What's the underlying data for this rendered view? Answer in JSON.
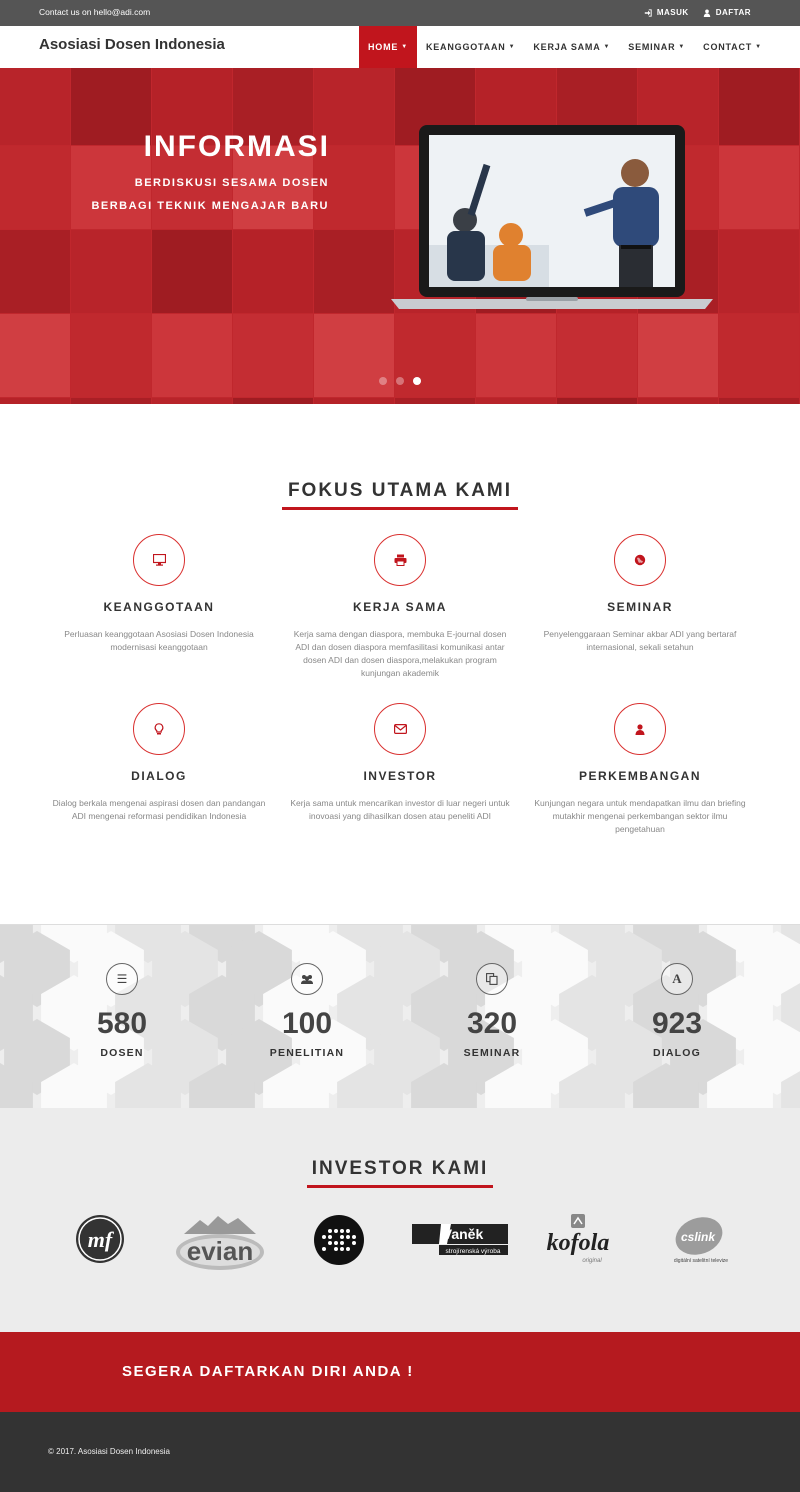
{
  "topbar": {
    "contact": "Contact us on hello@adi.com",
    "login": "MASUK",
    "register": "DAFTAR"
  },
  "navbar": {
    "brand": "Asosiasi Dosen Indonesia",
    "menu": [
      "HOME",
      "KEANGGOTAAN",
      "KERJA SAMA",
      "SEMINAR",
      "CONTACT"
    ],
    "active": "HOME"
  },
  "hero": {
    "title": "INFORMASI",
    "line1": "BERDISKUSI SESAMA DOSEN",
    "line2": "BERBAGI TEKNIK MENGAJAR BARU",
    "slides": 3,
    "active_slide": 3
  },
  "focus": {
    "title": "FOKUS UTAMA KAMI",
    "items": [
      {
        "icon": "monitor-icon",
        "title": "KEANGGOTAAN",
        "text": "Perluasan keanggotaan Asosiasi Dosen Indonesia modernisasi keanggotaan"
      },
      {
        "icon": "printer-icon",
        "title": "KERJA SAMA",
        "text": "Kerja sama dengan diaspora, membuka E-journal dosen ADI dan dosen diaspora memfasilitasi komunikasi antar dosen ADI dan dosen diaspora,melakukan program kunjungan akademik"
      },
      {
        "icon": "globe-icon",
        "title": "SEMINAR",
        "text": "Penyelenggaraan Seminar akbar ADI yang bertaraf internasional, sekali setahun"
      },
      {
        "icon": "lightbulb-icon",
        "title": "DIALOG",
        "text": "Dialog berkala mengenai aspirasi dosen dan pandangan ADI mengenai reformasi pendidikan Indonesia"
      },
      {
        "icon": "envelope-icon",
        "title": "INVESTOR",
        "text": "Kerja sama untuk mencarikan investor di luar negeri untuk inovoasi yang dihasilkan dosen atau peneliti ADI"
      },
      {
        "icon": "user-icon",
        "title": "PERKEMBANGAN",
        "text": "Kunjungan negara untuk mendapatkan ilmu dan briefing mutakhir mengenai perkembangan sektor ilmu pengetahuan"
      }
    ]
  },
  "stats": [
    {
      "icon": "list-icon",
      "number": "580",
      "label": "DOSEN"
    },
    {
      "icon": "users-icon",
      "number": "100",
      "label": "PENELITIAN"
    },
    {
      "icon": "copy-icon",
      "number": "320",
      "label": "SEMINAR"
    },
    {
      "icon": "font-icon",
      "number": "923",
      "label": "DIALOG"
    }
  ],
  "investors": {
    "title": "INVESTOR KAMI",
    "logos": [
      {
        "name": "mf-logo",
        "text": "mf"
      },
      {
        "name": "evian-logo",
        "text": "evian"
      },
      {
        "name": "dots-logo",
        "text": ""
      },
      {
        "name": "vanek-logo",
        "text": "Vaněk",
        "sub": "strojírenská výroba"
      },
      {
        "name": "kofola-logo",
        "text": "kofola",
        "sub": "original"
      },
      {
        "name": "cslink-logo",
        "text": "cslink",
        "sub": "digitální satelitní televize"
      }
    ]
  },
  "cta": {
    "text": "SEGERA DAFTARKAN DIRI ANDA !"
  },
  "footer": {
    "copyright": "© 2017. Asosiasi Dosen Indonesia"
  },
  "colors": {
    "accent": "#c1151d",
    "hero_red": "#c0272d",
    "topbar": "#555555",
    "footer": "#333333"
  }
}
